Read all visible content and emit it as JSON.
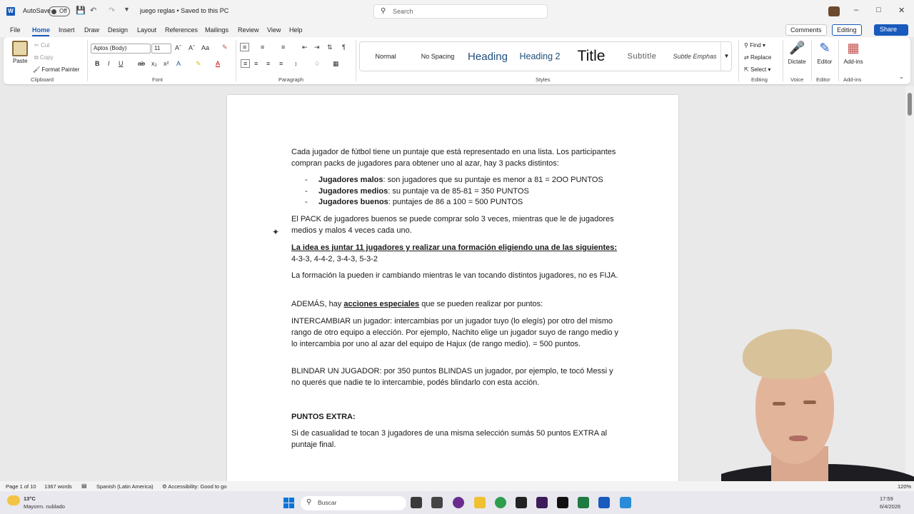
{
  "titlebar": {
    "autosave_label": "AutoSave",
    "autosave_state": "Off",
    "doc_title": "juego reglas • Saved to this PC",
    "search_placeholder": "Search"
  },
  "menu": [
    "File",
    "Home",
    "Insert",
    "Draw",
    "Design",
    "Layout",
    "References",
    "Mailings",
    "Review",
    "View",
    "Help"
  ],
  "menu_active": "Home",
  "top_right": {
    "comments": "Comments",
    "editing": "Editing",
    "share": "Share"
  },
  "ribbon": {
    "clipboard": {
      "paste": "Paste",
      "cut": "Cut",
      "copy": "Copy",
      "format_painter": "Format Painter",
      "label": "Clipboard"
    },
    "font": {
      "name": "Aptos (Body)",
      "size": "11",
      "label": "Font"
    },
    "paragraph": {
      "label": "Paragraph"
    },
    "styles": {
      "items": [
        "Normal",
        "No Spacing",
        "Heading",
        "Heading 2",
        "Title",
        "Subtitle",
        "Subtle Emphas"
      ],
      "label": "Styles"
    },
    "editing": {
      "find": "Find",
      "replace": "Replace",
      "select": "Select",
      "label": "Editing"
    },
    "voice": {
      "dictate": "Dictate",
      "label": "Voice"
    },
    "editor": {
      "editor": "Editor",
      "label": "Editor"
    },
    "addins": {
      "addins": "Add-ins",
      "label": "Add-ins"
    }
  },
  "document": {
    "p1": "Cada jugador de fútbol tiene un puntaje que está representado en una lista. Los participantes compran packs de jugadores para obtener uno al azar, hay 3 packs distintos:",
    "bullets": [
      {
        "bold": "Jugadores malos",
        "text": ": son jugadores que su puntaje es menor a 81 = 2OO PUNTOS"
      },
      {
        "bold": "Jugadores medios",
        "text": ": su puntaje va de 85-81 = 350 PUNTOS"
      },
      {
        "bold": "Jugadores buenos",
        "text": ": puntajes de 86 a 100 = 500 PUNTOS"
      }
    ],
    "p2": "El PACK de jugadores buenos se puede comprar solo 3 veces, mientras que le de jugadores medios y malos 4 veces cada uno.",
    "p3_bold": "La idea es juntar 11 jugadores y realizar una formación eligiendo una de las siguientes:",
    "p3_text": " 4-3-3, 4-4-2, 3-4-3, 5-3-2",
    "p4": "La formación la pueden ir cambiando mientras le van tocando distintos jugadores, no es FIJA.",
    "p5_a": "ADEMÁS, hay ",
    "p5_b": "acciones especiales",
    "p5_c": " que se pueden realizar por puntos:",
    "p6": "INTERCAMBIAR un jugador: intercambias por un jugador tuyo (lo elegís) por otro del mismo rango de otro equipo a elección. Por ejemplo, Nachito elige un jugador suyo de rango medio y lo intercambia por uno al azar del equipo de Hajux (de rango medio). = 500 puntos.",
    "p7": "BLINDAR UN JUGADOR: por 350 puntos BLINDAS un jugador, por ejemplo, te tocó Messi y no querés que nadie te lo intercambie, podés blindarlo con esta acción.",
    "p8": "PUNTOS EXTRA:",
    "p9": "Si de casualidad te tocan 3 jugadores de una misma selección sumás 50 puntos EXTRA al puntaje final."
  },
  "status": {
    "page": "Page 1 of 10",
    "words": "1367 words",
    "language": "Spanish (Latin America)",
    "accessibility": "Accessibility: Good to go",
    "zoom": "120%"
  },
  "taskbar": {
    "temp": "13°C",
    "weather": "Mayorm. nublado",
    "search": "Buscar",
    "time": "17:59",
    "date": "6/4/2026"
  }
}
